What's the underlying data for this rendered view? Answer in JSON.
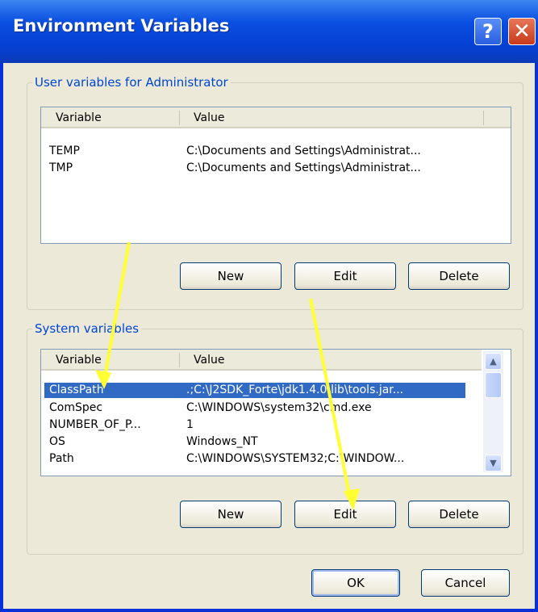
{
  "window": {
    "title": "Environment Variables",
    "help_glyph": "?",
    "close_glyph": "✕"
  },
  "user_section": {
    "legend": "User variables for Administrator",
    "columns": [
      "Variable",
      "Value"
    ],
    "rows": [
      {
        "variable": "TEMP",
        "value": "C:\\Documents and Settings\\Administrat..."
      },
      {
        "variable": "TMP",
        "value": "C:\\Documents and Settings\\Administrat..."
      }
    ],
    "buttons": {
      "new": "New",
      "edit": "Edit",
      "delete": "Delete"
    }
  },
  "system_section": {
    "legend": "System variables",
    "columns": [
      "Variable",
      "Value"
    ],
    "rows": [
      {
        "variable": "ClassPath",
        "value": ".;C:\\J2SDK_Forte\\jdk1.4.0\\lib\\tools.jar...",
        "selected": true
      },
      {
        "variable": "ComSpec",
        "value": "C:\\WINDOWS\\system32\\cmd.exe"
      },
      {
        "variable": "NUMBER_OF_P...",
        "value": "1"
      },
      {
        "variable": "OS",
        "value": "Windows_NT"
      },
      {
        "variable": "Path",
        "value": "C:\\WINDOWS\\SYSTEM32;C:\\WINDOW..."
      }
    ],
    "buttons": {
      "new": "New",
      "edit": "Edit",
      "delete": "Delete"
    }
  },
  "footer": {
    "ok": "OK",
    "cancel": "Cancel"
  },
  "colors": {
    "selection": "#316ac5",
    "annotation_arrows": "#ffff33",
    "titlebar": "#0a4ee0"
  },
  "annotations": [
    {
      "from": "user-list-area",
      "to": "ClassPath row"
    },
    {
      "from": "user-buttons-area",
      "to": "system Edit button"
    }
  ]
}
